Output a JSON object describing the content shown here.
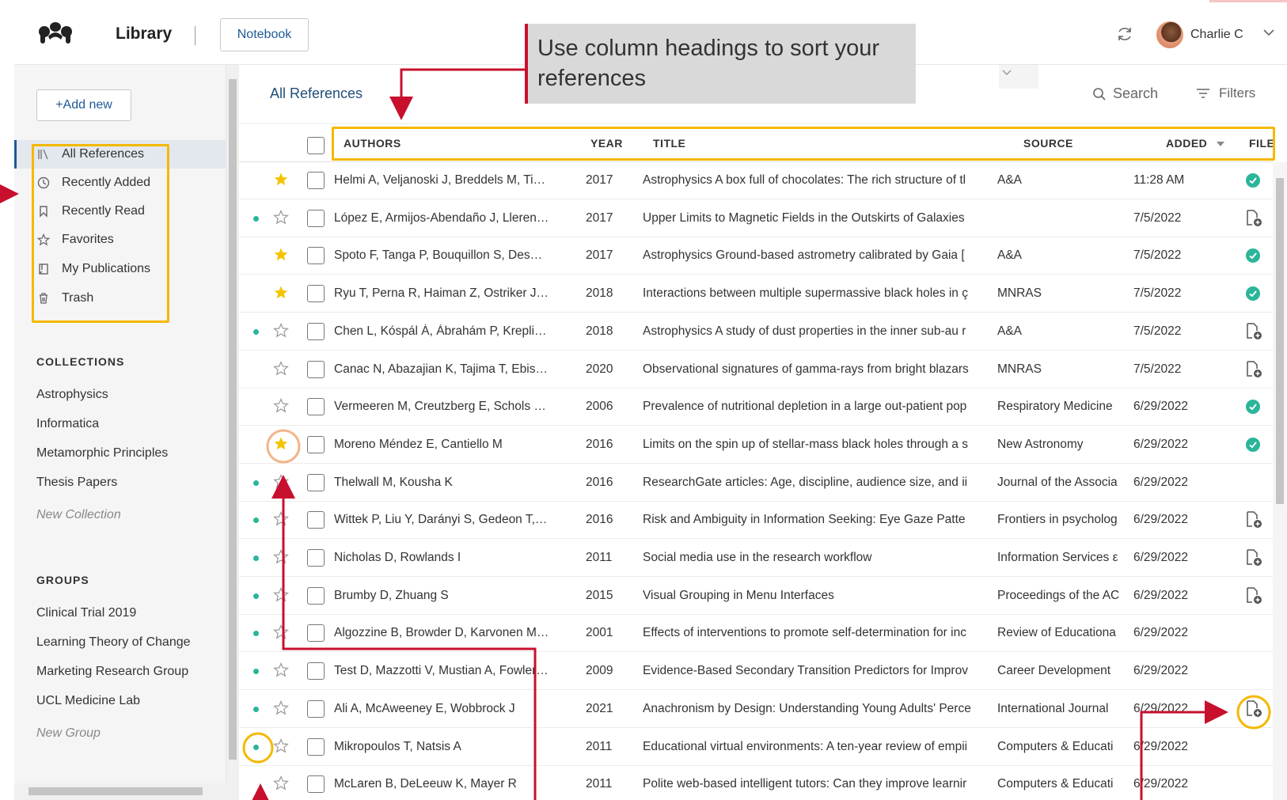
{
  "header": {
    "library_title": "Library",
    "notebook_label": "Notebook",
    "user_name": "Charlie C",
    "icons": [
      "mendeley-logo-icon",
      "sync-icon",
      "chevron-down-icon"
    ]
  },
  "sidebar": {
    "add_new_label": "+Add new",
    "nav": [
      {
        "label": "All References",
        "icon": "library-icon",
        "active": true
      },
      {
        "label": "Recently Added",
        "icon": "clock-icon"
      },
      {
        "label": "Recently Read",
        "icon": "bookmark-icon"
      },
      {
        "label": "Favorites",
        "icon": "star-icon"
      },
      {
        "label": "My Publications",
        "icon": "publication-icon"
      },
      {
        "label": "Trash",
        "icon": "trash-icon"
      }
    ],
    "collections_heading": "COLLECTIONS",
    "collections": [
      "Astrophysics",
      "Informatica",
      "Metamorphic Principles",
      "Thesis Papers"
    ],
    "new_collection": "New Collection",
    "groups_heading": "GROUPS",
    "groups": [
      "Clinical Trial 2019",
      "Learning Theory of Change",
      "Marketing Research Group",
      "UCL Medicine Lab"
    ],
    "new_group": "New Group"
  },
  "main": {
    "title": "All References",
    "search_label": "Search",
    "filters_label": "Filters",
    "callout_text": "Use column headings to sort your references",
    "columns": {
      "authors": "AUTHORS",
      "year": "YEAR",
      "title": "TITLE",
      "source": "SOURCE",
      "added": "ADDED",
      "file": "FILE"
    },
    "sort_column": "added",
    "sort_direction": "descending"
  },
  "rows": [
    {
      "authors": "Helmi A, Veljanoski J, Breddels M, Ti…",
      "year": "2017",
      "title": "Astrophysics A box full of chocolates: The rich structure of tl",
      "source": "A&A",
      "added": "11:28 AM",
      "unread": false,
      "favorite": true,
      "file": "pdf"
    },
    {
      "authors": "López E, Armijos-Abendaño J, Lleren…",
      "year": "2017",
      "title": "Upper Limits to Magnetic Fields in the Outskirts of Galaxies",
      "source": "",
      "added": "7/5/2022",
      "unread": true,
      "favorite": false,
      "file": "add"
    },
    {
      "authors": "Spoto F, Tanga P, Bouquillon S, Des…",
      "year": "2017",
      "title": "Astrophysics Ground-based astrometry calibrated by Gaia [",
      "source": "A&A",
      "added": "7/5/2022",
      "unread": false,
      "favorite": true,
      "file": "pdf"
    },
    {
      "authors": "Ryu T, Perna R, Haiman Z, Ostriker J…",
      "year": "2018",
      "title": "Interactions between multiple supermassive black holes in ç",
      "source": "MNRAS",
      "added": "7/5/2022",
      "unread": false,
      "favorite": true,
      "file": "pdf"
    },
    {
      "authors": "Chen L, Kóspál Á, Ábrahám P, Krepli…",
      "year": "2018",
      "title": "Astrophysics A study of dust properties in the inner sub-au r",
      "source": "A&A",
      "added": "7/5/2022",
      "unread": true,
      "favorite": false,
      "file": "add"
    },
    {
      "authors": "Canac N, Abazajian K, Tajima T, Ebis…",
      "year": "2020",
      "title": "Observational signatures of gamma-rays from bright blazars",
      "source": "MNRAS",
      "added": "7/5/2022",
      "unread": false,
      "favorite": false,
      "file": "add"
    },
    {
      "authors": "Vermeeren M, Creutzberg E, Schols …",
      "year": "2006",
      "title": "Prevalence of nutritional depletion in a large out-patient pop",
      "source": "Respiratory Medicine",
      "added": "6/29/2022",
      "unread": false,
      "favorite": false,
      "file": "pdf"
    },
    {
      "authors": "Moreno Méndez E, Cantiello M",
      "year": "2016",
      "title": "Limits on the spin up of stellar-mass black holes through a s",
      "source": "New Astronomy",
      "added": "6/29/2022",
      "unread": false,
      "favorite": true,
      "file": "pdf"
    },
    {
      "authors": "Thelwall M, Kousha K",
      "year": "2016",
      "title": "ResearchGate articles: Age, discipline, audience size, and ii",
      "source": "Journal of the Associa",
      "added": "6/29/2022",
      "unread": true,
      "favorite": false,
      "file": "none"
    },
    {
      "authors": "Wittek P, Liu Y, Darányi S, Gedeon T,…",
      "year": "2016",
      "title": "Risk and Ambiguity in Information Seeking: Eye Gaze Patte",
      "source": "Frontiers in psycholog",
      "added": "6/29/2022",
      "unread": true,
      "favorite": false,
      "file": "add"
    },
    {
      "authors": "Nicholas D, Rowlands I",
      "year": "2011",
      "title": "Social media use in the research workflow",
      "source": "Information Services ε",
      "added": "6/29/2022",
      "unread": true,
      "favorite": false,
      "file": "add"
    },
    {
      "authors": "Brumby D, Zhuang S",
      "year": "2015",
      "title": "Visual Grouping in Menu Interfaces",
      "source": "Proceedings of the AC",
      "added": "6/29/2022",
      "unread": true,
      "favorite": false,
      "file": "add"
    },
    {
      "authors": "Algozzine B, Browder D, Karvonen M…",
      "year": "2001",
      "title": "Effects of interventions to promote self-determination for inc",
      "source": "Review of Educationa",
      "added": "6/29/2022",
      "unread": true,
      "favorite": false,
      "file": "none"
    },
    {
      "authors": "Test D, Mazzotti V, Mustian A, Fowler…",
      "year": "2009",
      "title": "Evidence-Based Secondary Transition Predictors for Improv",
      "source": "Career Development",
      "added": "6/29/2022",
      "unread": true,
      "favorite": false,
      "file": "none"
    },
    {
      "authors": "Ali A, McAweeney E, Wobbrock J",
      "year": "2021",
      "title": "Anachronism by Design: Understanding Young Adults' Perce",
      "source": "International Journal",
      "added": "6/29/2022",
      "unread": true,
      "favorite": false,
      "file": "add"
    },
    {
      "authors": "Mikropoulos T, Natsis A",
      "year": "2011",
      "title": "Educational virtual environments: A ten-year review of empii",
      "source": "Computers & Educati",
      "added": "6/29/2022",
      "unread": true,
      "favorite": false,
      "file": "none"
    },
    {
      "authors": "McLaren B, DeLeeuw K, Mayer R",
      "year": "2011",
      "title": "Polite web-based intelligent tutors: Can they improve learnir",
      "source": "Computers & Educati",
      "added": "6/29/2022",
      "unread": false,
      "favorite": false,
      "file": "none"
    }
  ],
  "colors": {
    "accent_blue": "#1f5a96",
    "unread_dot": "#2bb59a",
    "favorite_star": "#f5c400",
    "annotation_red": "#c8102e",
    "annotation_yellow": "#f5b800",
    "annotation_orange": "#f3b48a"
  }
}
